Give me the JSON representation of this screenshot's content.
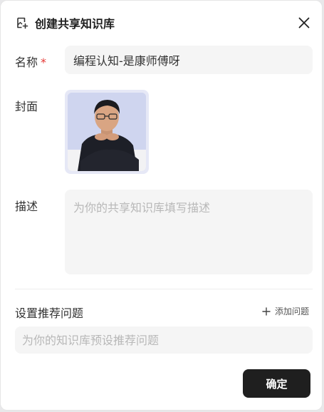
{
  "dialog": {
    "title": "创建共享知识库",
    "title_icon": "new-library-icon",
    "close_icon": "close-icon"
  },
  "form": {
    "name_label": "名称",
    "required_mark": "*",
    "name_value": "编程认知-是康师傅呀",
    "cover_label": "封面",
    "cover_image": "cover-avatar-image",
    "desc_label": "描述",
    "desc_placeholder": "为你的共享知识库填写描述",
    "recommend_label": "设置推荐问题",
    "add_question_label": "添加问题",
    "add_question_icon": "plus-icon",
    "recommend_placeholder": "为你的知识库预设推荐问题"
  },
  "footer": {
    "confirm_label": "确定"
  },
  "colors": {
    "primary_button": "#1f1f1f",
    "required": "#e53935",
    "input_bg": "#f5f5f5",
    "cover_bg": "#cfd5ef"
  }
}
